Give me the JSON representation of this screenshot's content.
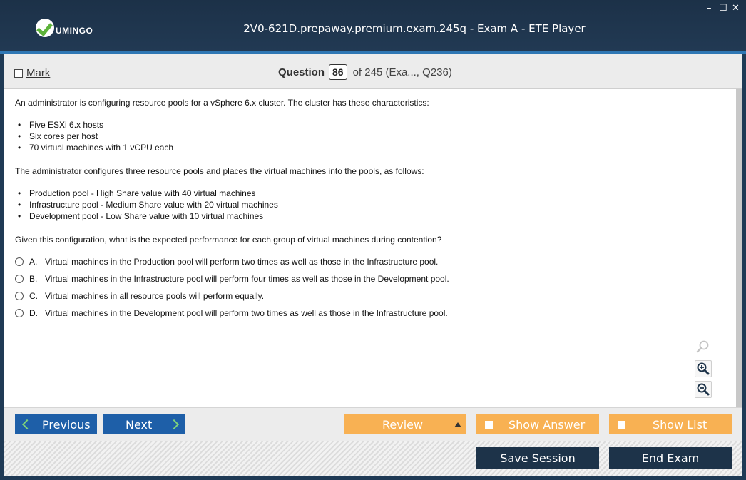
{
  "window": {
    "title": "2V0-621D.prepaway.premium.exam.245q - Exam A - ETE Player",
    "logo_text": "UMINGO",
    "minimize_glyph": "–",
    "maximize_glyph": "☐",
    "close_glyph": "✕"
  },
  "header": {
    "mark_label": "Mark",
    "question_label": "Question",
    "question_number": "86",
    "question_of": "of 245 (Exa..., Q236)"
  },
  "question": {
    "intro": "An administrator is configuring resource pools for a vSphere 6.x cluster. The cluster has these characteristics:",
    "characteristics": [
      "Five ESXi 6.x hosts",
      "Six cores per host",
      "70 virtual machines with 1 vCPU each"
    ],
    "config_intro": "The administrator configures three resource pools and places the virtual machines into the pools, as follows:",
    "pools": [
      "Production pool - High Share value with 40 virtual machines",
      "Infrastructure pool - Medium Share value with 20 virtual machines",
      "Development pool - Low Share value with 10 virtual machines"
    ],
    "prompt": "Given this configuration, what is the expected performance for each group of virtual machines during contention?",
    "options": [
      {
        "letter": "A.",
        "text": "Virtual machines in the Production pool will perform two times as well as those in the Infrastructure pool."
      },
      {
        "letter": "B.",
        "text": "Virtual machines in the Infrastructure pool will perform four times as well as those in the Development pool."
      },
      {
        "letter": "C.",
        "text": "Virtual machines in all resource pools will perform equally."
      },
      {
        "letter": "D.",
        "text": "Virtual machines in the Development pool will perform two times as well as those in the Infrastructure pool."
      }
    ]
  },
  "navigation": {
    "previous_label": "Previous",
    "next_label": "Next",
    "review_label": "Review",
    "show_answer_label": "Show Answer",
    "show_list_label": "Show List"
  },
  "footer": {
    "save_session_label": "Save Session",
    "end_exam_label": "End Exam"
  },
  "colors": {
    "title_bar": "#1c3148",
    "accent_blue": "#2f77b4",
    "button_blue": "#1e5fa8",
    "button_orange": "#f8b153",
    "button_navy": "#1d3349",
    "logo_green": "#5db33a"
  }
}
